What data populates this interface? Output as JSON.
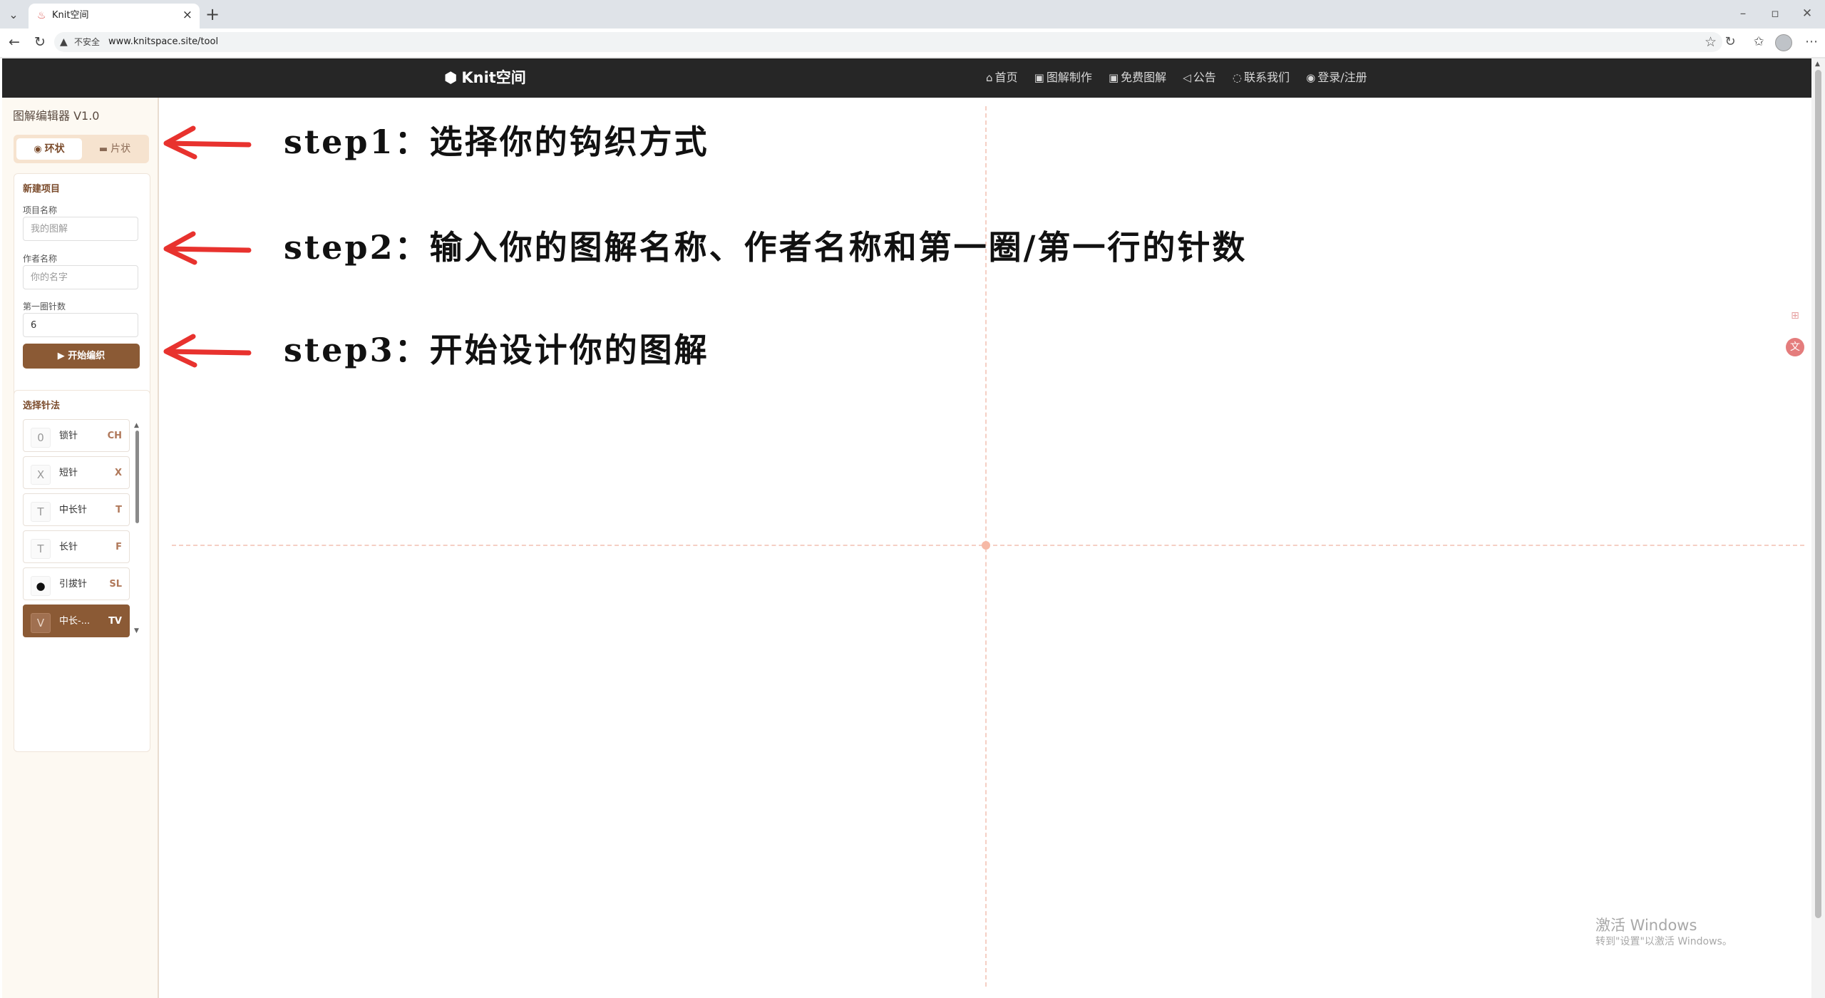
{
  "browser": {
    "tab_title": "Knit空间",
    "security_label": "不安全",
    "url": "www.knitspace.site/tool"
  },
  "header": {
    "logo": "Knit空间",
    "nav": [
      {
        "icon": "home-icon",
        "label": "首页"
      },
      {
        "icon": "chart-design-icon",
        "label": "图解制作"
      },
      {
        "icon": "free-chart-icon",
        "label": "免费图解"
      },
      {
        "icon": "megaphone-icon",
        "label": "公告"
      },
      {
        "icon": "chat-icon",
        "label": "联系我们"
      },
      {
        "icon": "user-icon",
        "label": "登录/注册"
      }
    ]
  },
  "sidebar": {
    "editor_title": "图解编辑器 V1.0",
    "modes": {
      "ring": "环状",
      "flat": "片状",
      "selected": "环状"
    },
    "new_project": {
      "title": "新建项目",
      "name_label": "项目名称",
      "name_placeholder": "我的图解",
      "author_label": "作者名称",
      "author_placeholder": "你的名字",
      "count_label": "第一圈针数",
      "count_value": "6",
      "start_button": "开始编织"
    },
    "stitch_panel": {
      "title": "选择针法",
      "stitches": [
        {
          "symbol": "0",
          "name": "锁针",
          "abbr": "CH",
          "active": false
        },
        {
          "symbol": "X",
          "name": "短针",
          "abbr": "X",
          "active": false
        },
        {
          "symbol": "T",
          "name": "中长针",
          "abbr": "T",
          "active": false
        },
        {
          "symbol": "T",
          "name": "长针",
          "abbr": "F",
          "active": false
        },
        {
          "symbol": "●",
          "name": "引拔针",
          "abbr": "SL",
          "active": false
        },
        {
          "symbol": "V",
          "name": "中长-...",
          "abbr": "TV",
          "active": true
        }
      ]
    }
  },
  "canvas": {
    "steps": [
      "step1：选择你的钩织方式",
      "step2：输入你的图解名称、作者名称和第一圈/第一行的针数",
      "step3：开始设计你的图解"
    ],
    "arrow_color": "#e8322e",
    "guide_color": "#f5cfc4"
  },
  "watermark": {
    "line1": "激活 Windows",
    "line2": "转到\"设置\"以激活 Windows。"
  },
  "colors": {
    "brand": "#8b5a35",
    "header_bg": "#262626",
    "sidebar_bg": "#fdf9f2"
  }
}
